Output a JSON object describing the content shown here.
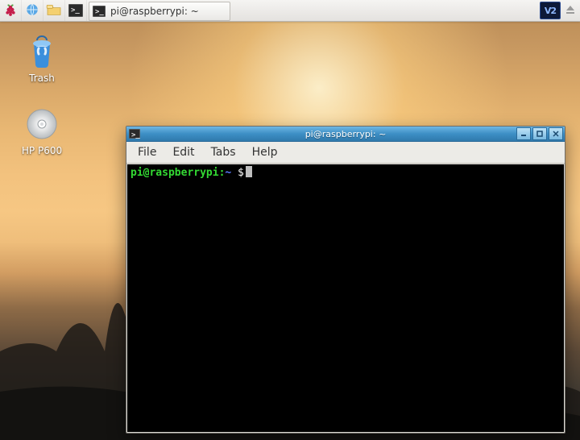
{
  "panel": {
    "menu_icon": "raspberry-icon",
    "browser_icon": "globe-icon",
    "files_icon": "folder-icon",
    "terminal_icon": "terminal-icon",
    "task_label": "pi@raspberrypi: ~",
    "tray_vnc": "V2",
    "tray_eject": "eject-icon"
  },
  "desktop_icons": {
    "trash": {
      "label": "Trash"
    },
    "disc": {
      "label": "HP P600"
    }
  },
  "terminal": {
    "title": "pi@raspberrypi: ~",
    "menus": {
      "file": "File",
      "edit": "Edit",
      "tabs": "Tabs",
      "help": "Help"
    },
    "prompt_user": "pi@raspberrypi",
    "prompt_sep": ":",
    "prompt_path": "~",
    "prompt_dollar": " $"
  }
}
